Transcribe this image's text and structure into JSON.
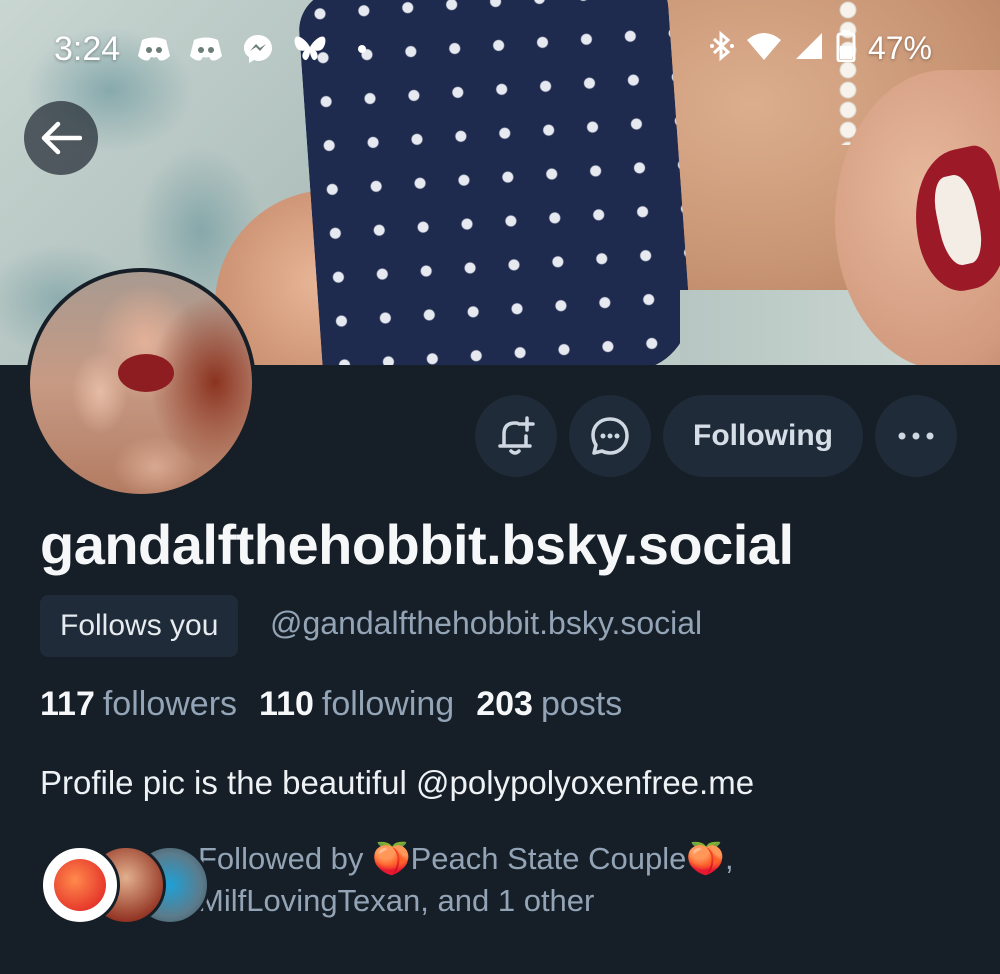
{
  "status_bar": {
    "time": "3:24",
    "battery": "47%",
    "left_icons": [
      "discord-icon",
      "discord-icon",
      "messenger-icon",
      "bluesky-icon",
      "dot-icon"
    ],
    "right_icons": [
      "bluetooth-icon",
      "wifi-icon",
      "cell-signal-icon",
      "battery-icon"
    ]
  },
  "header": {
    "back_icon": "arrow-left-icon"
  },
  "actions": {
    "subscribe_icon": "bell-plus-icon",
    "message_icon": "chat-bubble-icon",
    "follow_label": "Following",
    "more_icon": "ellipsis-icon"
  },
  "profile": {
    "display_name": "gandalfthehobbit.bsky.social",
    "follows_you": "Follows you",
    "handle": "@gandalfthehobbit.bsky.social",
    "stats": {
      "followers_count": "117",
      "followers_label": "followers",
      "following_count": "110",
      "following_label": "following",
      "posts_count": "203",
      "posts_label": "posts"
    },
    "bio": "Profile pic is the beautiful @polypolyoxenfree.me",
    "followed_by": "Followed by 🍑Peach State Couple🍑, MilfLovingTexan, and 1 other"
  },
  "colors": {
    "background": "#161e27",
    "button_bg": "#1f2b38",
    "muted_text": "#93a4b6",
    "primary_text": "#f5f7f9"
  }
}
